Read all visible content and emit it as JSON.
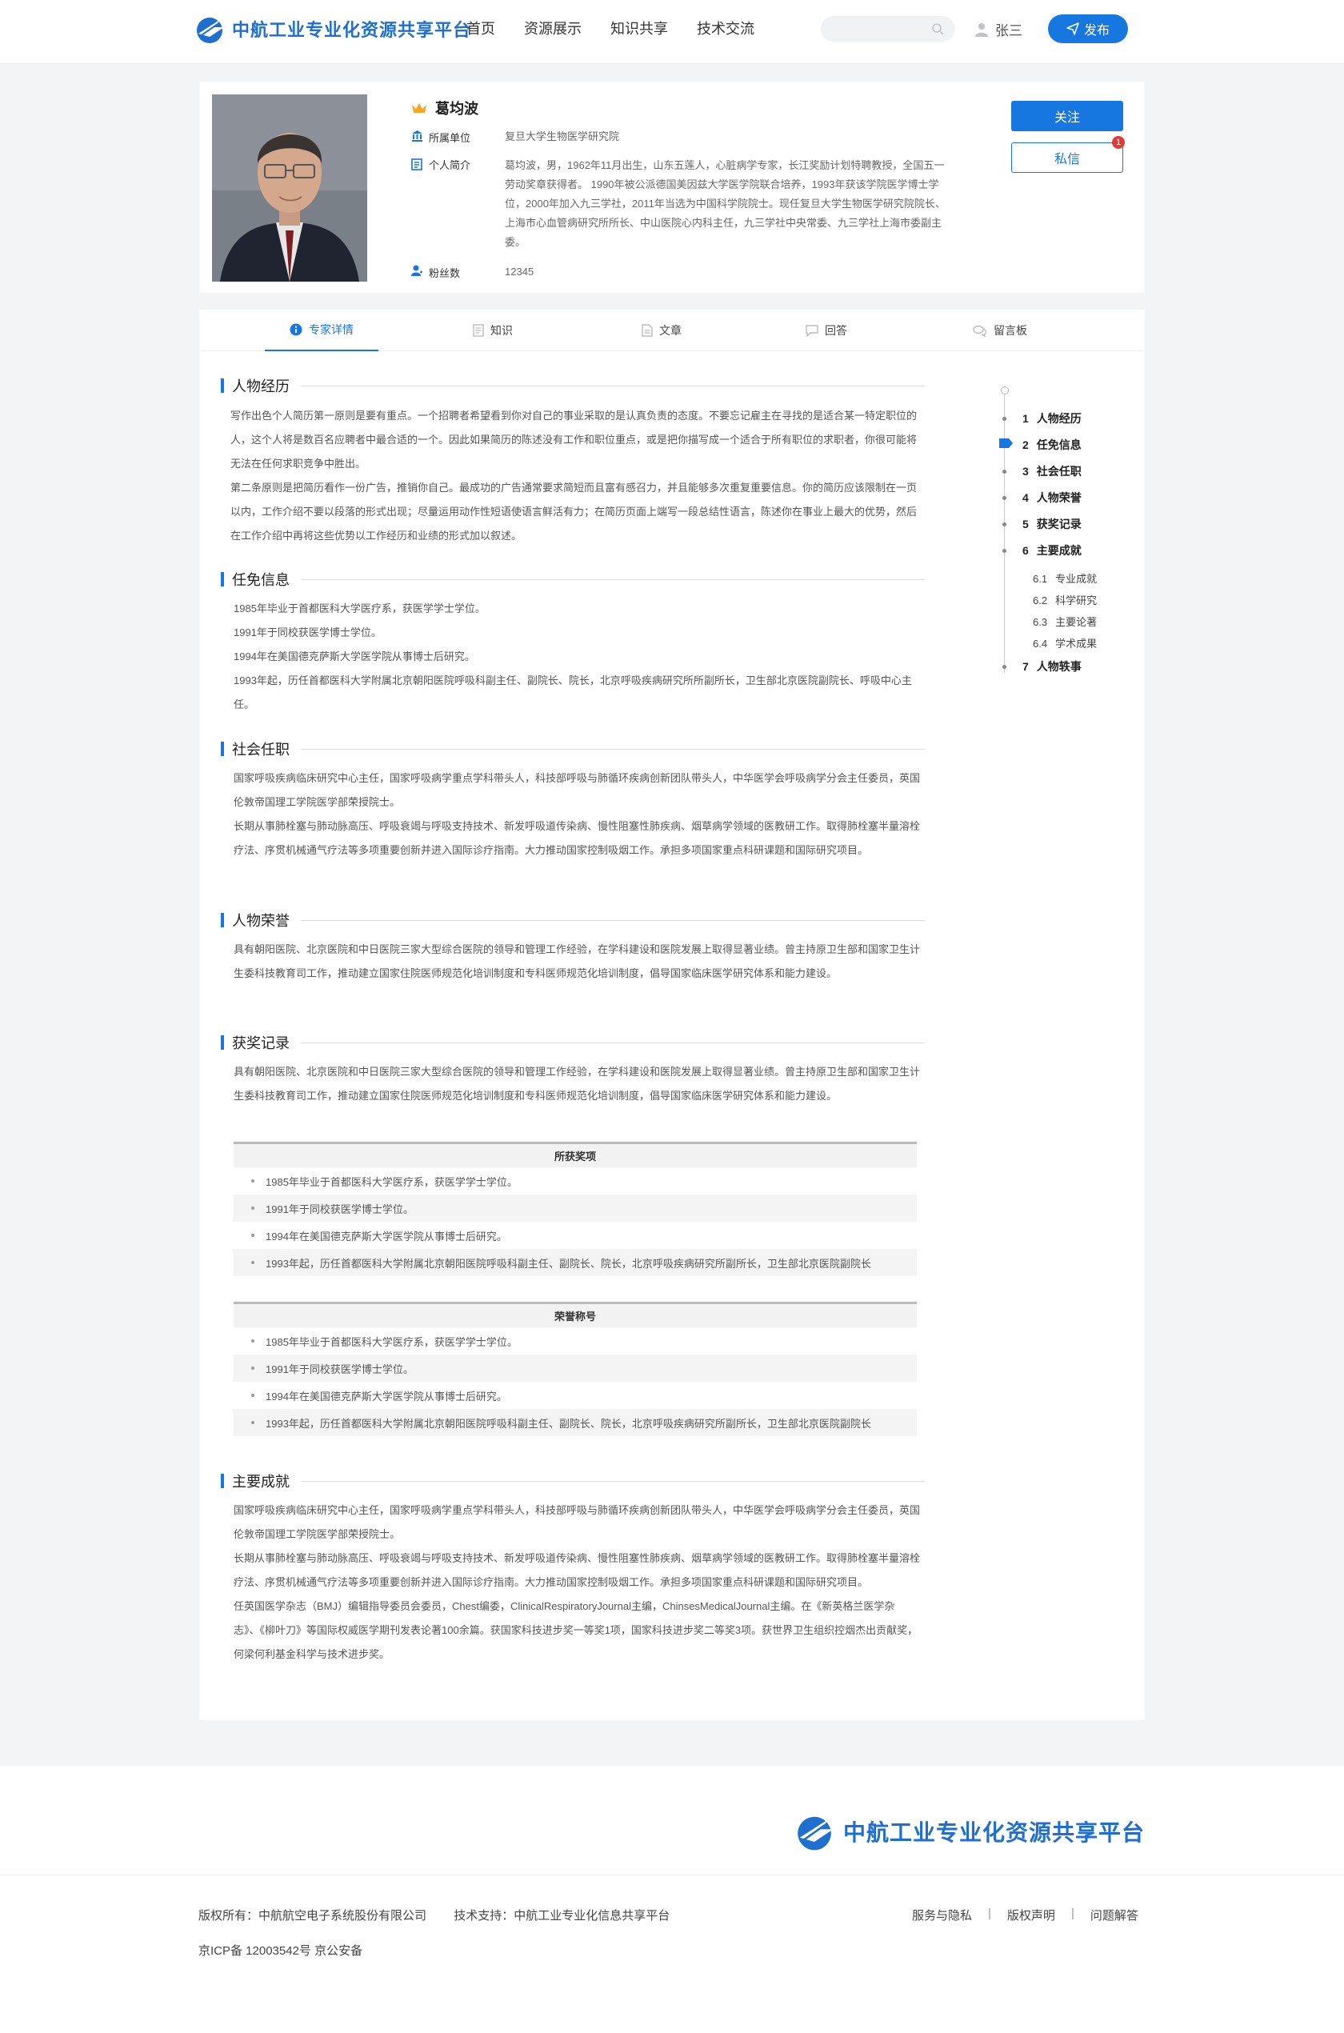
{
  "site": {
    "name": "中航工业专业化资源共享平台"
  },
  "nav": [
    {
      "label": "首页"
    },
    {
      "label": "资源展示"
    },
    {
      "label": "知识共享"
    },
    {
      "label": "技术交流"
    }
  ],
  "search": {
    "placeholder": ""
  },
  "user": {
    "name": "张三"
  },
  "publish_label": "发布",
  "profile": {
    "name": "葛均波",
    "unit_label": "所属单位",
    "unit": "复旦大学生物医学研究院",
    "intro_label": "个人简介",
    "intro": "葛均波，男，1962年11月出生，山东五莲人，心脏病学专家，长江奖励计划特聘教授，全国五一劳动奖章获得者。 1990年被公派德国美因兹大学医学院联合培养，1993年获该学院医学博士学位，2000年加入九三学社，2011年当选为中国科学院院士。现任复旦大学生物医学研究院院长、上海市心血管病研究所所长、中山医院心内科主任，九三学社中央常委、九三学社上海市委副主委。",
    "fans_label": "粉丝数",
    "fans": "12345",
    "follow_label": "关注",
    "message_label": "私信",
    "message_badge": "1"
  },
  "tabs": [
    {
      "label": "专家详情",
      "icon": "info-icon"
    },
    {
      "label": "知识",
      "icon": "document-icon"
    },
    {
      "label": "文章",
      "icon": "file-icon"
    },
    {
      "label": "回答",
      "icon": "chat-icon"
    },
    {
      "label": "留言板",
      "icon": "comments-icon"
    }
  ],
  "sections": {
    "history": {
      "title": "人物经历",
      "paragraphs": [
        "写作出色个人简历第一原则是要有重点。一个招聘者希望看到你对自己的事业采取的是认真负责的态度。不要忘记雇主在寻找的是适合某一特定职位的人，这个人将是数百名应聘者中最合适的一个。因此如果简历的陈述没有工作和职位重点，或是把你描写成一个适合于所有职位的求职者，你很可能将无法在任何求职竞争中胜出。",
        "第二条原则是把简历看作一份广告，推销你自己。最成功的广告通常要求简短而且富有感召力，并且能够多次重复重要信息。你的简历应该限制在一页以内，工作介绍不要以段落的形式出现；尽量运用动作性短语使语言鲜活有力；在简历页面上端写一段总结性语言，陈述你在事业上最大的优势，然后在工作介绍中再将这些优势以工作经历和业绩的形式加以叙述。"
      ]
    },
    "appoint": {
      "title": "任免信息",
      "paragraphs": [
        "1985年毕业于首都医科大学医疗系，获医学学士学位。",
        "1991年于同校获医学博士学位。",
        "1994年在美国德克萨斯大学医学院从事博士后研究。",
        "1993年起，历任首都医科大学附属北京朝阳医院呼吸科副主任、副院长、院长，北京呼吸疾病研究所所副所长，卫生部北京医院副院长、呼吸中心主任。"
      ]
    },
    "social": {
      "title": "社会任职",
      "paragraphs": [
        "国家呼吸疾病临床研究中心主任，国家呼吸病学重点学科带头人，科技部呼吸与肺循环疾病创新团队带头人，中华医学会呼吸病学分会主任委员，英国伦敦帝国理工学院医学部荣授院士。",
        "长期从事肺栓塞与肺动脉高压、呼吸衰竭与呼吸支持技术、新发呼吸道传染病、慢性阻塞性肺疾病、烟草病学领域的医教研工作。取得肺栓塞半量溶栓疗法、序贯机械通气疗法等多项重要创新并进入国际诊疗指南。大力推动国家控制吸烟工作。承担多项国家重点科研课题和国际研究项目。"
      ]
    },
    "honor": {
      "title": "人物荣誉",
      "paragraphs": [
        "具有朝阳医院、北京医院和中日医院三家大型综合医院的领导和管理工作经验，在学科建设和医院发展上取得显著业绩。曾主持原卫生部和国家卫生计生委科技教育司工作，推动建立国家住院医师规范化培训制度和专科医师规范化培训制度，倡导国家临床医学研究体系和能力建设。"
      ]
    },
    "awards": {
      "title": "获奖记录",
      "paragraphs": [
        "具有朝阳医院、北京医院和中日医院三家大型综合医院的领导和管理工作经验，在学科建设和医院发展上取得显著业绩。曾主持原卫生部和国家卫生计生委科技教育司工作，推动建立国家住院医师规范化培训制度和专科医师规范化培训制度，倡导国家临床医学研究体系和能力建设。"
      ],
      "table1": {
        "title": "所获奖项",
        "rows": [
          "1985年毕业于首都医科大学医疗系，获医学学士学位。",
          "1991年于同校获医学博士学位。",
          "1994年在美国德克萨斯大学医学院从事博士后研究。",
          "1993年起，历任首都医科大学附属北京朝阳医院呼吸科副主任、副院长、院长，北京呼吸疾病研究所副所长，卫生部北京医院副院长"
        ]
      },
      "table2": {
        "title": "荣誉称号",
        "rows": [
          "1985年毕业于首都医科大学医疗系，获医学学士学位。",
          "1991年于同校获医学博士学位。",
          "1994年在美国德克萨斯大学医学院从事博士后研究。",
          "1993年起，历任首都医科大学附属北京朝阳医院呼吸科副主任、副院长、院长，北京呼吸疾病研究所副所长，卫生部北京医院副院长"
        ]
      }
    },
    "achieve": {
      "title": "主要成就",
      "paragraphs": [
        "国家呼吸疾病临床研究中心主任，国家呼吸病学重点学科带头人，科技部呼吸与肺循环疾病创新团队带头人，中华医学会呼吸病学分会主任委员，英国伦敦帝国理工学院医学部荣授院士。",
        "长期从事肺栓塞与肺动脉高压、呼吸衰竭与呼吸支持技术、新发呼吸道传染病、慢性阻塞性肺疾病、烟草病学领域的医教研工作。取得肺栓塞半量溶栓疗法、序贯机械通气疗法等多项重要创新并进入国际诊疗指南。大力推动国家控制吸烟工作。承担多项国家重点科研课题和国际研究项目。",
        "任英国医学杂志（BMJ）编辑指导委员会委员，Chest编委，ClinicalRespiratoryJournal主编，ChinsesMedicalJournal主编。在《新英格兰医学杂志》、《柳叶刀》等国际权威医学期刊发表论著100余篇。获国家科技进步奖一等奖1项，国家科技进步奖二等奖3项。获世界卫生组织控烟杰出贡献奖，何梁何利基金科学与技术进步奖。"
      ]
    }
  },
  "toc": {
    "items": [
      {
        "num": "1",
        "label": "人物经历"
      },
      {
        "num": "2",
        "label": "任免信息"
      },
      {
        "num": "3",
        "label": "社会任职"
      },
      {
        "num": "4",
        "label": "人物荣誉"
      },
      {
        "num": "5",
        "label": "获奖记录"
      },
      {
        "num": "6",
        "label": "主要成就"
      },
      {
        "num": "7",
        "label": "人物轶事"
      }
    ],
    "subs": [
      {
        "num": "6.1",
        "label": "专业成就"
      },
      {
        "num": "6.2",
        "label": "科学研究"
      },
      {
        "num": "6.3",
        "label": "主要论著"
      },
      {
        "num": "6.4",
        "label": "学术成果"
      }
    ]
  },
  "footer": {
    "copyright": "版权所有：中航航空电子系统股份有限公司",
    "support": "技术支持：中航工业专业化信息共享平台",
    "links": [
      "服务与隐私",
      "版权声明",
      "问题解答"
    ],
    "icp": "京ICP备 12003542号 京公安备"
  },
  "colors": {
    "accent": "#1677e0",
    "brand": "#1e6fcf",
    "badge": "#e53935"
  }
}
